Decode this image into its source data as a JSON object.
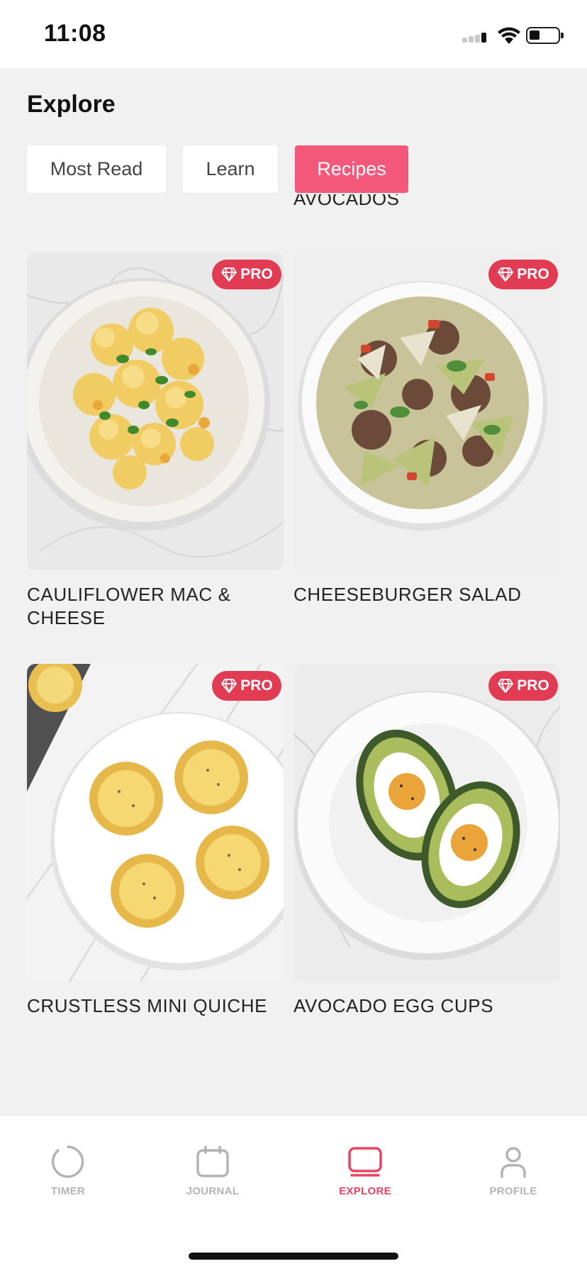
{
  "status_bar": {
    "time": "11:08"
  },
  "header": {
    "title": "Explore"
  },
  "tabs": [
    {
      "label": "Most Read",
      "active": false
    },
    {
      "label": "Learn",
      "active": false
    },
    {
      "label": "Recipes",
      "active": true
    }
  ],
  "previous_item_title": "AVOCADOS",
  "recipes": [
    {
      "name": "CAULIFLOWER MAC & CHEESE",
      "badge": "PRO",
      "icon": "cauliflower-dish-photo"
    },
    {
      "name": "CHEESEBURGER SALAD",
      "badge": "PRO",
      "icon": "salad-bowl-photo"
    },
    {
      "name": "CRUSTLESS MINI QUICHE",
      "badge": "PRO",
      "icon": "mini-quiche-photo"
    },
    {
      "name": "AVOCADO EGG CUPS",
      "badge": "PRO",
      "icon": "avocado-egg-photo"
    }
  ],
  "nav": [
    {
      "label": "TIMER",
      "icon": "timer-icon",
      "active": false
    },
    {
      "label": "JOURNAL",
      "icon": "journal-icon",
      "active": false
    },
    {
      "label": "EXPLORE",
      "icon": "explore-icon",
      "active": true
    },
    {
      "label": "PROFILE",
      "icon": "profile-icon",
      "active": false
    }
  ],
  "colors": {
    "accent": "#f3587a",
    "badge": "#e23c55",
    "nav_active": "#ea4361",
    "nav_inactive": "#b4b4b4"
  }
}
